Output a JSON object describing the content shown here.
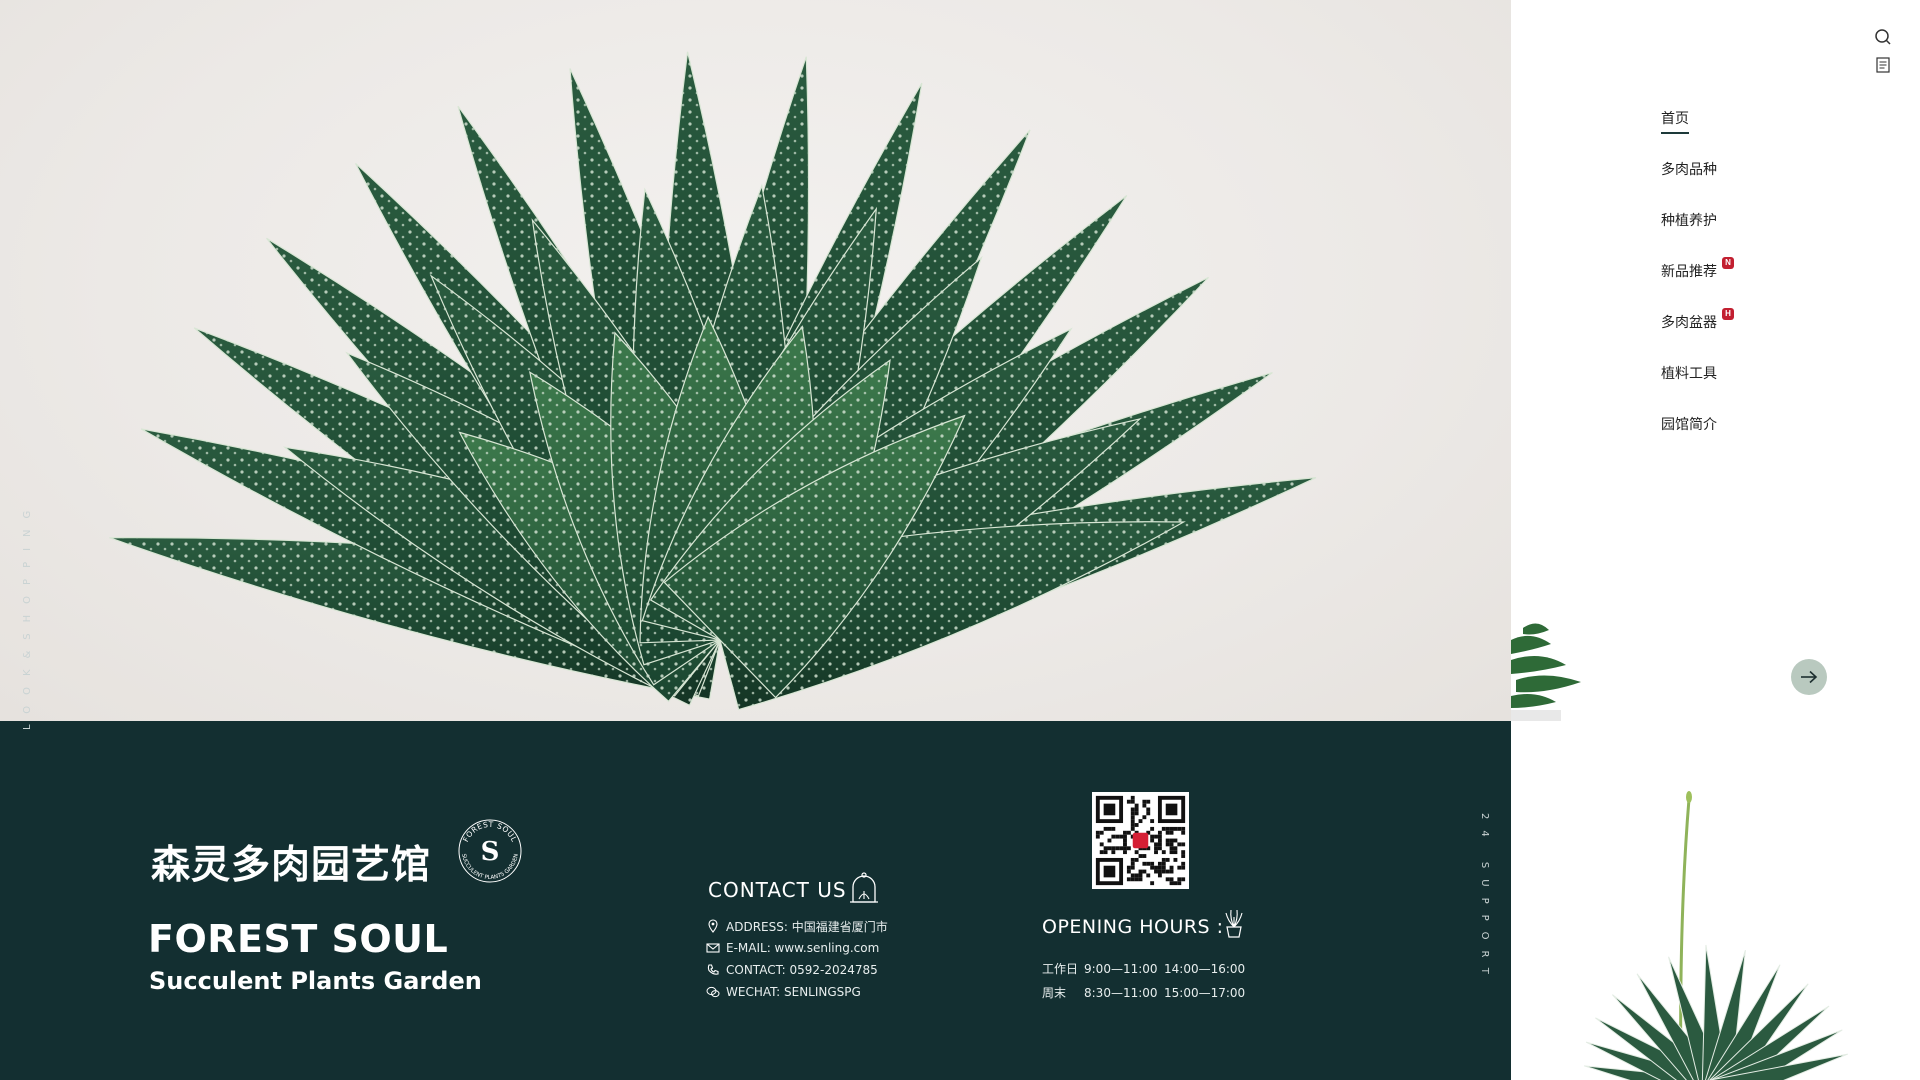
{
  "header": {
    "icons": [
      "search-icon",
      "menu-list-icon"
    ]
  },
  "nav": {
    "items": [
      {
        "label": "首页",
        "active": true,
        "badge": ""
      },
      {
        "label": "多肉品种",
        "active": false,
        "badge": ""
      },
      {
        "label": "种植养护",
        "active": false,
        "badge": ""
      },
      {
        "label": "新品推荐",
        "active": false,
        "badge": "N"
      },
      {
        "label": "多肉盆器",
        "active": false,
        "badge": "H"
      },
      {
        "label": "植料工具",
        "active": false,
        "badge": ""
      },
      {
        "label": "园馆简介",
        "active": false,
        "badge": ""
      }
    ]
  },
  "hero": {
    "next_button_icon": "arrow-right-icon"
  },
  "footer": {
    "side_left": "LOOK&SHOPPING",
    "side_right": "24 SUPPORT",
    "brand_cn": "森灵多肉园艺馆",
    "seal": {
      "letter": "S",
      "ring_top": "FOREST SOUL",
      "ring_bottom": "SUCCULENT PLANTS GARDEN"
    },
    "brand_en": "FOREST SOUL",
    "brand_sub": "Succulent Plants Garden",
    "contact": {
      "title": "CONTACT US",
      "rows": [
        {
          "icon": "location-pin-icon",
          "text": "ADDRESS: 中国福建省厦门市"
        },
        {
          "icon": "mail-icon",
          "text": "E-MAIL: www.senling.com"
        },
        {
          "icon": "phone-icon",
          "text": "CONTACT: 0592-2024785"
        },
        {
          "icon": "wechat-icon",
          "text": "WECHAT: SENLINGSPG"
        }
      ]
    },
    "hours": {
      "title": "OPENING HOURS :",
      "rows": [
        {
          "day": "工作日",
          "t1": "9:00—11:00",
          "t2": "14:00—16:00"
        },
        {
          "day": "周末",
          "t1": "8:30—11:00",
          "t2": "15:00—17:00"
        }
      ]
    }
  },
  "colors": {
    "footer_bg": "#132f31",
    "badge": "#c21f30",
    "next_button": "#b9c9bf",
    "hero_bg": "#ece9e6"
  }
}
